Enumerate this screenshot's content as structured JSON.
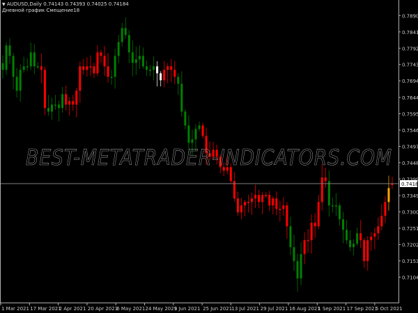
{
  "header": {
    "symbol_line": "AUDUSD,Daily  0.74143 0.74393 0.74025 0.74184",
    "indicator_line": "Дневной график   Смещение18",
    "collapse_icon": "triangle-down-icon"
  },
  "watermark": "BEST-METATRADER-INDICATORS.COM",
  "current_price_label": "0.74184",
  "chart_data": {
    "type": "candlestick",
    "title": "AUDUSD,Daily",
    "ohlc_last": {
      "open": 0.74143,
      "high": 0.74393,
      "low": 0.74025,
      "close": 0.74184
    },
    "current_price": 0.74184,
    "ylim": [
      0.7068,
      0.7922
    ],
    "y_ticks": [
      "0.78900",
      "0.78410",
      "0.77920",
      "0.77430",
      "0.76940",
      "0.76440",
      "0.75950",
      "0.75460",
      "0.74970",
      "0.74480",
      "0.73990",
      "0.73490",
      "0.73000",
      "0.72510",
      "0.72020",
      "0.71530",
      "0.71040"
    ],
    "x_ticks": [
      "1 Mar 2021",
      "17 Mar 2021",
      "2 Apr 2021",
      "20 Apr 2021",
      "6 May 2021",
      "24 May 2021",
      "9 Jun 2021",
      "25 Jun 2021",
      "13 Jul 2021",
      "29 Jul 2021",
      "16 Aug 2021",
      "1 Sep 2021",
      "17 Sep 2021",
      "5 Oct 2021"
    ],
    "colors": {
      "G": "#008000",
      "R": "#ff0000",
      "W": "#ffffff",
      "O": "#ffa500"
    },
    "closes": [
      0.77604,
      0.78336,
      0.78022,
      0.77395,
      0.76977,
      0.77604,
      0.77709,
      0.77709,
      0.78127,
      0.77709,
      0.77709,
      0.77604,
      0.76455,
      0.7635,
      0.76559,
      0.76559,
      0.76455,
      0.76873,
      0.76559,
      0.76664,
      0.76559,
      0.76977,
      0.77709,
      0.77604,
      0.77709,
      0.77709,
      0.775,
      0.78127,
      0.78022,
      0.77709,
      0.77395,
      0.77395,
      0.78022,
      0.7844,
      0.78858,
      0.78649,
      0.78127,
      0.77813,
      0.77918,
      0.78022,
      0.77709,
      0.77604,
      0.77604,
      0.77709,
      0.775,
      0.77291,
      0.77604,
      0.77709,
      0.77604,
      0.77395,
      0.77186,
      0.7635,
      0.75932,
      0.7541,
      0.75514,
      0.75828,
      0.75932,
      0.75619,
      0.75096,
      0.74992,
      0.75201,
      0.74992,
      0.74678,
      0.74574,
      0.74678,
      0.7426,
      0.73738,
      0.7332,
      0.73529,
      0.73633,
      0.73633,
      0.73738,
      0.73842,
      0.73633,
      0.73842,
      0.73842,
      0.73529,
      0.73738,
      0.73424,
      0.73424,
      0.73529,
      0.72902,
      0.72275,
      0.71857,
      0.71334,
      0.72066,
      0.72484,
      0.72484,
      0.73006,
      0.72902,
      0.73633,
      0.74365,
      0.7426,
      0.73529,
      0.73529,
      0.73529,
      0.73111,
      0.72797,
      0.72484,
      0.72275,
      0.72379,
      0.72693,
      0.72484,
      0.71857,
      0.72484,
      0.72588,
      0.72693,
      0.72902,
      0.73215,
      0.73633,
      0.74051,
      0.74184
    ],
    "candle_colors": "GGGGGGGGGGGRRGGGGGRRRRRRRRRRRRRGGGGGGGGGGGGGWWRRRRGGGGGGGRRRRRRRRRRRRRRRRRRRRRRRRRGGGGRRRRRRRGGGGGGGGGRRRRRRRRO"
  }
}
